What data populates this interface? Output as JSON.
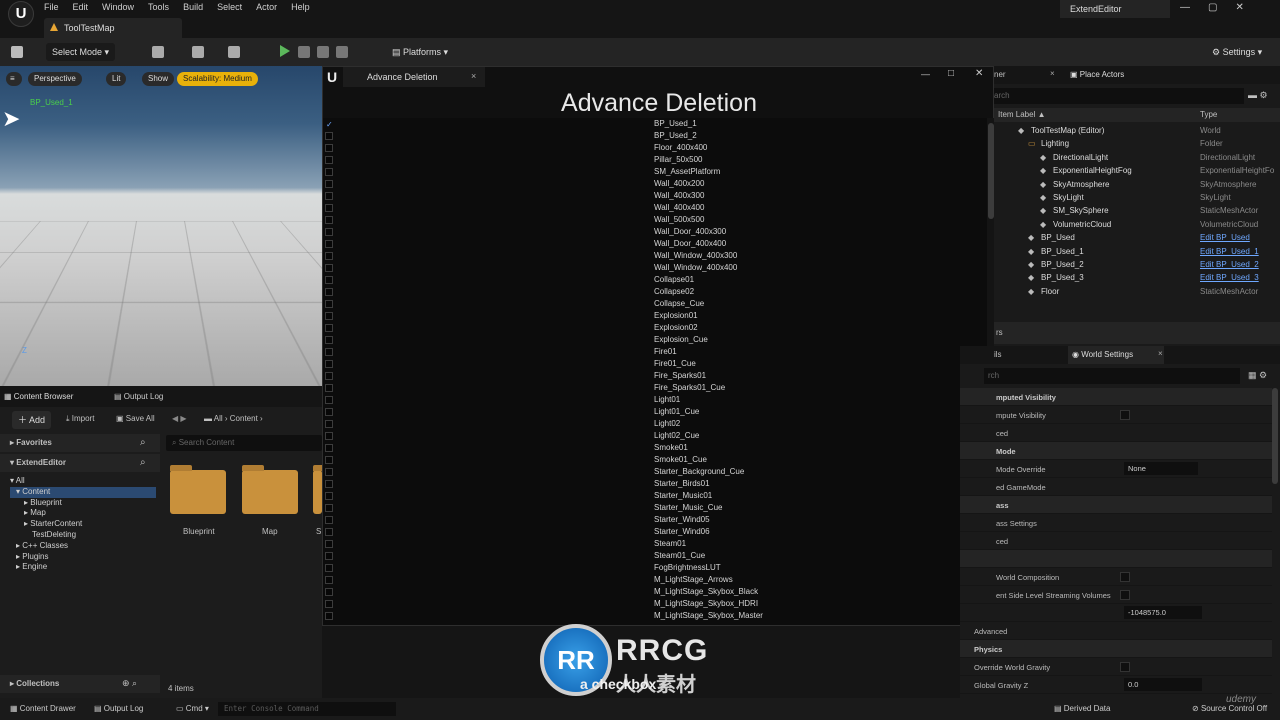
{
  "menubar": {
    "items": [
      "File",
      "Edit",
      "Window",
      "Tools",
      "Build",
      "Select",
      "Actor",
      "Help"
    ],
    "project": "ExtendEditor",
    "logo": "U"
  },
  "doc_tab": {
    "label": "ToolTestMap"
  },
  "toolbar": {
    "select_mode": "Select Mode",
    "platforms": "Platforms",
    "settings": "Settings"
  },
  "viewport": {
    "perspective": "Perspective",
    "lit": "Lit",
    "show": "Show",
    "scalability": "Scalability: Medium",
    "actor_label": "BP_Used_1",
    "axis_label": "Z"
  },
  "content_browser": {
    "tab": "Content Browser",
    "output_tab": "Output Log",
    "add": "Add",
    "import": "Import",
    "save_all": "Save All",
    "path": [
      "All",
      "Content"
    ],
    "favorites": "Favorites",
    "project": "ExtendEditor",
    "search_placeholder": "Search Content",
    "tree": [
      "All",
      "Content",
      "Blueprint",
      "Map",
      "StarterContent",
      "TestDeleting",
      "C++ Classes",
      "Plugins",
      "Engine"
    ],
    "assets": [
      "Blueprint",
      "Map",
      "S"
    ],
    "collections": "Collections",
    "count": "4 items"
  },
  "dialog": {
    "tab": "Advance Deletion",
    "title": "Advance Deletion",
    "logo": "U",
    "close": "×",
    "min": "—",
    "max": "□",
    "close_win": "✕",
    "assets": [
      "BP_Used_1",
      "BP_Used_2",
      "Floor_400x400",
      "Pillar_50x500",
      "SM_AssetPlatform",
      "Wall_400x200",
      "Wall_400x300",
      "Wall_400x400",
      "Wall_500x500",
      "Wall_Door_400x300",
      "Wall_Door_400x400",
      "Wall_Window_400x300",
      "Wall_Window_400x400",
      "Collapse01",
      "Collapse02",
      "Collapse_Cue",
      "Explosion01",
      "Explosion02",
      "Explosion_Cue",
      "Fire01",
      "Fire01_Cue",
      "Fire_Sparks01",
      "Fire_Sparks01_Cue",
      "Light01",
      "Light01_Cue",
      "Light02",
      "Light02_Cue",
      "Smoke01",
      "Smoke01_Cue",
      "Starter_Background_Cue",
      "Starter_Birds01",
      "Starter_Music01",
      "Starter_Music_Cue",
      "Starter_Wind05",
      "Starter_Wind06",
      "Steam01",
      "Steam01_Cue",
      "FogBrightnessLUT",
      "M_LightStage_Arrows",
      "M_LightStage_Skybox_Black",
      "M_LightStage_Skybox_HDRI",
      "M_LightStage_Skybox_Master"
    ]
  },
  "outliner": {
    "tab_partial": "ner",
    "place_actors": "Place Actors",
    "search_partial": "arch",
    "col_label": "Item Label ▲",
    "col_type": "Type",
    "rows": [
      {
        "label": "ToolTestMap (Editor)",
        "type": "World",
        "link": false
      },
      {
        "label": "Lighting",
        "type": "Folder",
        "link": false
      },
      {
        "label": "DirectionalLight",
        "type": "DirectionalLight",
        "link": false
      },
      {
        "label": "ExponentialHeightFog",
        "type": "ExponentialHeightFo",
        "link": false
      },
      {
        "label": "SkyAtmosphere",
        "type": "SkyAtmosphere",
        "link": false
      },
      {
        "label": "SkyLight",
        "type": "SkyLight",
        "link": false
      },
      {
        "label": "SM_SkySphere",
        "type": "StaticMeshActor",
        "link": false
      },
      {
        "label": "VolumetricCloud",
        "type": "VolumetricCloud",
        "link": false
      },
      {
        "label": "BP_Used",
        "type": "Edit BP_Used",
        "link": true
      },
      {
        "label": "BP_Used_1",
        "type": "Edit BP_Used_1",
        "link": true
      },
      {
        "label": "BP_Used_2",
        "type": "Edit BP_Used_2",
        "link": true
      },
      {
        "label": "BP_Used_3",
        "type": "Edit BP_Used_3",
        "link": true
      },
      {
        "label": "Floor",
        "type": "StaticMeshActor",
        "link": false
      }
    ],
    "footer_partial": "rs"
  },
  "details": {
    "tab_partial": "ils",
    "world_settings": "World Settings",
    "search_partial": "rch",
    "rows": [
      {
        "label": "mputed Visibility",
        "section": true
      },
      {
        "label": "mpute Visibility",
        "section": false,
        "value": ""
      },
      {
        "label": "ced",
        "section": false,
        "value": ""
      },
      {
        "label": "Mode",
        "section": true
      },
      {
        "label": "Mode Override",
        "section": false,
        "value": "None"
      },
      {
        "label": "ed GameMode",
        "section": false,
        "value": ""
      },
      {
        "label": "ass",
        "section": true
      },
      {
        "label": "ass Settings",
        "section": false,
        "value": ""
      },
      {
        "label": "ced",
        "section": false,
        "value": ""
      },
      {
        "label": "",
        "section": true
      },
      {
        "label": "World Composition",
        "section": false,
        "value": ""
      },
      {
        "label": "ent Side Level Streaming Volumes",
        "section": false,
        "value": ""
      },
      {
        "label": "",
        "section": false,
        "value": "-1048575.0"
      },
      {
        "label": "Advanced",
        "section": false,
        "value": ""
      },
      {
        "label": "Physics",
        "section": true
      },
      {
        "label": "Override World Gravity",
        "section": false,
        "value": ""
      },
      {
        "label": "Global Gravity Z",
        "section": false,
        "value": "0.0"
      }
    ]
  },
  "statusbar": {
    "content_drawer": "Content Drawer",
    "output_log": "Output Log",
    "cmd": "Cmd",
    "console_placeholder": "Enter Console Command",
    "derived_data": "Derived Data",
    "source_control": "Source Control Off"
  },
  "watermark": {
    "badge": "RR",
    "text": "RRCG",
    "sub": "人人素材",
    "overlay": "a checkbox"
  },
  "udemy": "udemy"
}
